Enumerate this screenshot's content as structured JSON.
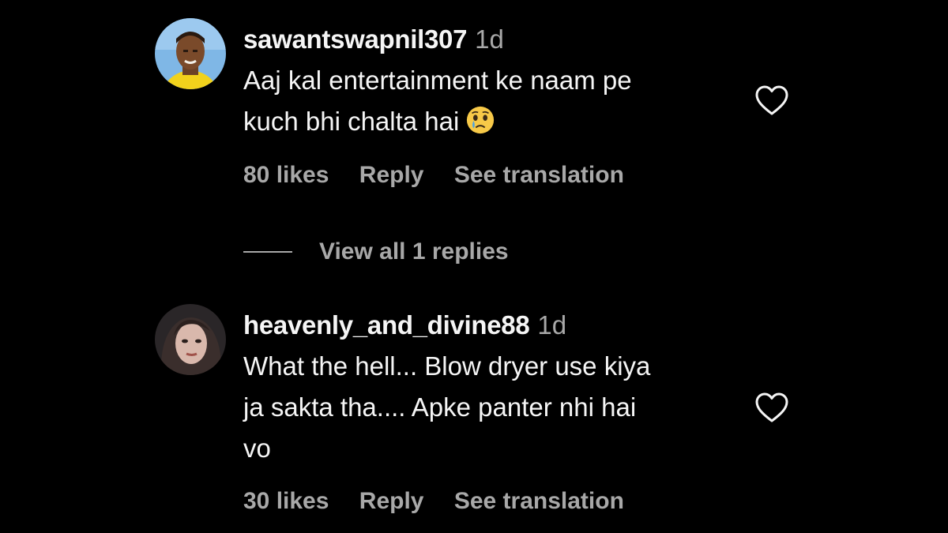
{
  "comments": [
    {
      "username": "sawantswapnil307",
      "time": "1d",
      "text_lines": [
        "Aaj kal entertainment ke naam pe",
        "kuch bhi chalta hai"
      ],
      "emoji": "crying-face-emoji",
      "likes": "80 likes",
      "reply": "Reply",
      "translate": "See translation",
      "like_icon": "heart-outline-icon"
    },
    {
      "username": "heavenly_and_divine88",
      "time": "1d",
      "text_lines": [
        "What the hell... Blow dryer use kiya",
        "ja sakta tha.... Apke panter nhi hai",
        "vo"
      ],
      "likes": "30 likes",
      "reply": "Reply",
      "translate": "See translation",
      "like_icon": "heart-outline-icon"
    }
  ],
  "replies_toggle": {
    "label": "View all 1 replies"
  },
  "colors": {
    "background": "#000000",
    "primary_text": "#f5f5f5",
    "secondary_text": "#a8a8a8",
    "emoji_face": "#f7c948"
  }
}
